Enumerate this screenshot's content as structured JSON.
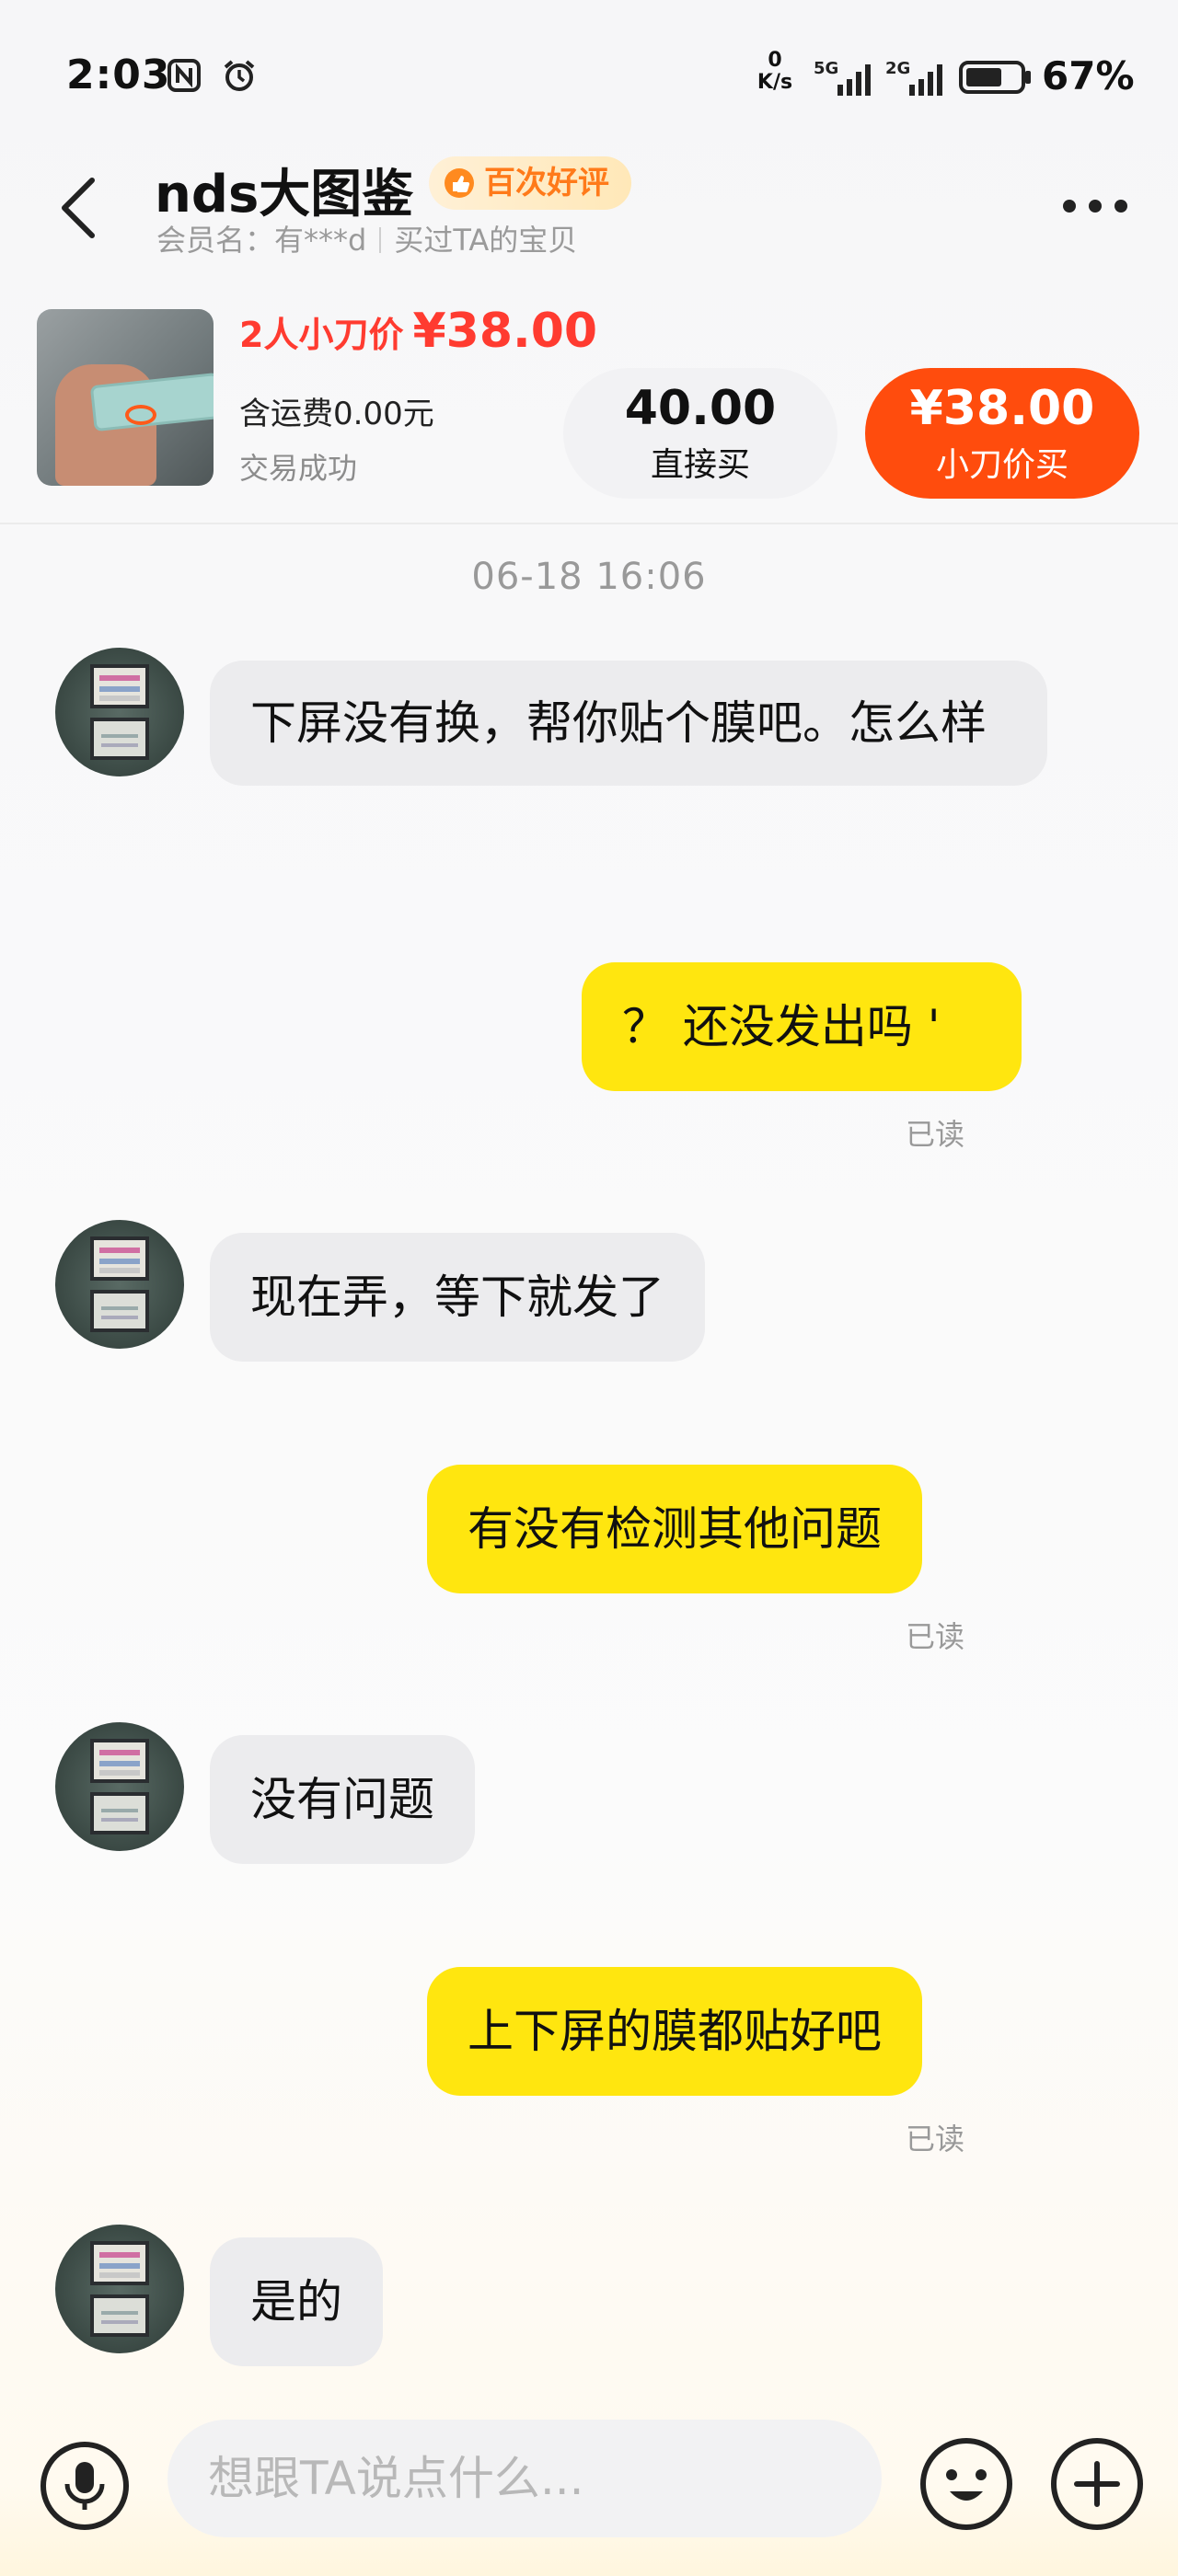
{
  "status_bar": {
    "time": "2:03",
    "net_speed_value": "0",
    "net_speed_unit": "K/s",
    "signal_1_label": "5G",
    "signal_2_label": "2G",
    "battery_percent": "67%",
    "battery_level": 0.67,
    "icons": [
      "nfc-icon",
      "alarm-icon",
      "signal-icon",
      "battery-icon"
    ]
  },
  "header": {
    "shop_name": "nds大图鉴",
    "badge_label": "百次好评",
    "member_label": "会员名：有***d",
    "bought_label": "买过TA的宝贝"
  },
  "product": {
    "bargain_label": "2人小刀价",
    "bargain_price": "¥38.00",
    "shipping": "含运费0.00元",
    "trade_status": "交易成功",
    "direct_buy_price": "40.00",
    "direct_buy_label": "直接买",
    "bargain_buy_price": "¥38.00",
    "bargain_buy_label": "小刀价买"
  },
  "chat": {
    "timestamp": "06-18 16:06",
    "messages": [
      {
        "side": "in",
        "text": "下屏没有换，帮你贴个膜吧。怎么样"
      },
      {
        "side": "out",
        "text": "？ 还没发出吗 '",
        "status": "已读"
      },
      {
        "side": "in",
        "text": "现在弄，等下就发了"
      },
      {
        "side": "out",
        "text": "有没有检测其他问题",
        "status": "已读"
      },
      {
        "side": "in",
        "text": "没有问题"
      },
      {
        "side": "out",
        "text": "上下屏的膜都贴好吧",
        "status": "已读"
      },
      {
        "side": "in",
        "text": "是的"
      }
    ]
  },
  "input_bar": {
    "placeholder": "想跟TA说点什么..."
  },
  "colors": {
    "accent_orange": "#ff4c0d",
    "price_red": "#ff3b30",
    "outgoing_bubble": "#ffe60f",
    "incoming_bubble": "#ececee"
  }
}
